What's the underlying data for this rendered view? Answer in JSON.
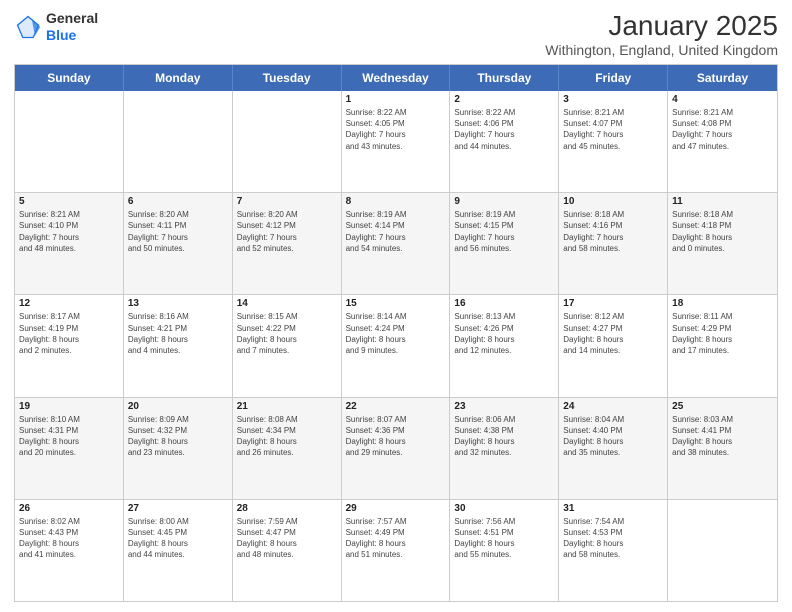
{
  "app": {
    "logo_line1": "General",
    "logo_line2": "Blue"
  },
  "title": "January 2025",
  "subtitle": "Withington, England, United Kingdom",
  "days_of_week": [
    "Sunday",
    "Monday",
    "Tuesday",
    "Wednesday",
    "Thursday",
    "Friday",
    "Saturday"
  ],
  "weeks": [
    [
      {
        "day": "",
        "info": ""
      },
      {
        "day": "",
        "info": ""
      },
      {
        "day": "",
        "info": ""
      },
      {
        "day": "1",
        "info": "Sunrise: 8:22 AM\nSunset: 4:05 PM\nDaylight: 7 hours\nand 43 minutes."
      },
      {
        "day": "2",
        "info": "Sunrise: 8:22 AM\nSunset: 4:06 PM\nDaylight: 7 hours\nand 44 minutes."
      },
      {
        "day": "3",
        "info": "Sunrise: 8:21 AM\nSunset: 4:07 PM\nDaylight: 7 hours\nand 45 minutes."
      },
      {
        "day": "4",
        "info": "Sunrise: 8:21 AM\nSunset: 4:08 PM\nDaylight: 7 hours\nand 47 minutes."
      }
    ],
    [
      {
        "day": "5",
        "info": "Sunrise: 8:21 AM\nSunset: 4:10 PM\nDaylight: 7 hours\nand 48 minutes."
      },
      {
        "day": "6",
        "info": "Sunrise: 8:20 AM\nSunset: 4:11 PM\nDaylight: 7 hours\nand 50 minutes."
      },
      {
        "day": "7",
        "info": "Sunrise: 8:20 AM\nSunset: 4:12 PM\nDaylight: 7 hours\nand 52 minutes."
      },
      {
        "day": "8",
        "info": "Sunrise: 8:19 AM\nSunset: 4:14 PM\nDaylight: 7 hours\nand 54 minutes."
      },
      {
        "day": "9",
        "info": "Sunrise: 8:19 AM\nSunset: 4:15 PM\nDaylight: 7 hours\nand 56 minutes."
      },
      {
        "day": "10",
        "info": "Sunrise: 8:18 AM\nSunset: 4:16 PM\nDaylight: 7 hours\nand 58 minutes."
      },
      {
        "day": "11",
        "info": "Sunrise: 8:18 AM\nSunset: 4:18 PM\nDaylight: 8 hours\nand 0 minutes."
      }
    ],
    [
      {
        "day": "12",
        "info": "Sunrise: 8:17 AM\nSunset: 4:19 PM\nDaylight: 8 hours\nand 2 minutes."
      },
      {
        "day": "13",
        "info": "Sunrise: 8:16 AM\nSunset: 4:21 PM\nDaylight: 8 hours\nand 4 minutes."
      },
      {
        "day": "14",
        "info": "Sunrise: 8:15 AM\nSunset: 4:22 PM\nDaylight: 8 hours\nand 7 minutes."
      },
      {
        "day": "15",
        "info": "Sunrise: 8:14 AM\nSunset: 4:24 PM\nDaylight: 8 hours\nand 9 minutes."
      },
      {
        "day": "16",
        "info": "Sunrise: 8:13 AM\nSunset: 4:26 PM\nDaylight: 8 hours\nand 12 minutes."
      },
      {
        "day": "17",
        "info": "Sunrise: 8:12 AM\nSunset: 4:27 PM\nDaylight: 8 hours\nand 14 minutes."
      },
      {
        "day": "18",
        "info": "Sunrise: 8:11 AM\nSunset: 4:29 PM\nDaylight: 8 hours\nand 17 minutes."
      }
    ],
    [
      {
        "day": "19",
        "info": "Sunrise: 8:10 AM\nSunset: 4:31 PM\nDaylight: 8 hours\nand 20 minutes."
      },
      {
        "day": "20",
        "info": "Sunrise: 8:09 AM\nSunset: 4:32 PM\nDaylight: 8 hours\nand 23 minutes."
      },
      {
        "day": "21",
        "info": "Sunrise: 8:08 AM\nSunset: 4:34 PM\nDaylight: 8 hours\nand 26 minutes."
      },
      {
        "day": "22",
        "info": "Sunrise: 8:07 AM\nSunset: 4:36 PM\nDaylight: 8 hours\nand 29 minutes."
      },
      {
        "day": "23",
        "info": "Sunrise: 8:06 AM\nSunset: 4:38 PM\nDaylight: 8 hours\nand 32 minutes."
      },
      {
        "day": "24",
        "info": "Sunrise: 8:04 AM\nSunset: 4:40 PM\nDaylight: 8 hours\nand 35 minutes."
      },
      {
        "day": "25",
        "info": "Sunrise: 8:03 AM\nSunset: 4:41 PM\nDaylight: 8 hours\nand 38 minutes."
      }
    ],
    [
      {
        "day": "26",
        "info": "Sunrise: 8:02 AM\nSunset: 4:43 PM\nDaylight: 8 hours\nand 41 minutes."
      },
      {
        "day": "27",
        "info": "Sunrise: 8:00 AM\nSunset: 4:45 PM\nDaylight: 8 hours\nand 44 minutes."
      },
      {
        "day": "28",
        "info": "Sunrise: 7:59 AM\nSunset: 4:47 PM\nDaylight: 8 hours\nand 48 minutes."
      },
      {
        "day": "29",
        "info": "Sunrise: 7:57 AM\nSunset: 4:49 PM\nDaylight: 8 hours\nand 51 minutes."
      },
      {
        "day": "30",
        "info": "Sunrise: 7:56 AM\nSunset: 4:51 PM\nDaylight: 8 hours\nand 55 minutes."
      },
      {
        "day": "31",
        "info": "Sunrise: 7:54 AM\nSunset: 4:53 PM\nDaylight: 8 hours\nand 58 minutes."
      },
      {
        "day": "",
        "info": ""
      }
    ]
  ]
}
